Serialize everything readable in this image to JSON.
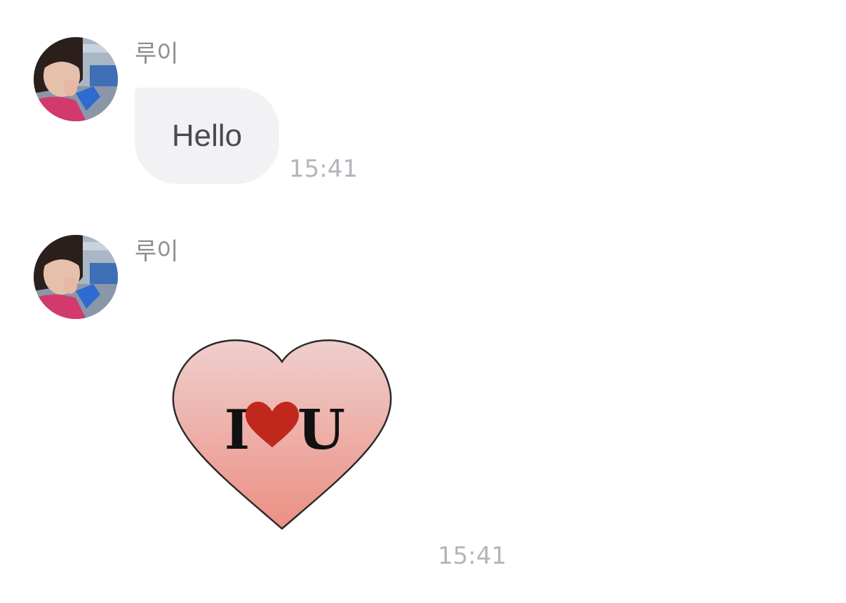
{
  "chat": {
    "messages": [
      {
        "sender": "루이",
        "type": "text",
        "text": "Hello",
        "time": "15:41"
      },
      {
        "sender": "루이",
        "type": "sticker",
        "sticker": {
          "left_letter": "I",
          "right_letter": "U",
          "icon": "heart-icon",
          "inner_heart_color": "#c0271d",
          "stroke_color": "#2a2a2a",
          "gradient_top": "#efcfcd",
          "gradient_bottom": "#ec8f83"
        },
        "time": "15:41"
      }
    ]
  },
  "colors": {
    "name_text": "#8e8e93",
    "timestamp_text": "#b4b4ba",
    "bubble_bg": "#f2f2f5",
    "bubble_text": "#4a4a50"
  }
}
